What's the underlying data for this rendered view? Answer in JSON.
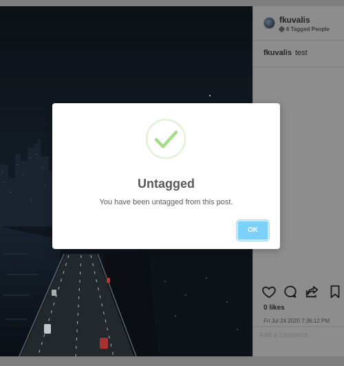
{
  "post": {
    "username": "fkuvalis",
    "tagged_people": "6 Tagged People",
    "caption_user": "fkuvalis",
    "caption_text": "test",
    "likes": "0 likes",
    "date": "Fri Jul 24 2020 7:36:12 PM",
    "comment_placeholder": "Add a comment..."
  },
  "icons": [
    "heart-icon",
    "comment-icon",
    "share-icon",
    "bookmark-icon",
    "tag-icon",
    "check-icon"
  ],
  "modal": {
    "title": "Untagged",
    "message": "You have been untagged from this post.",
    "ok_label": "OK",
    "accent_color": "#7cd1f9",
    "check_color": "#a5dc86"
  }
}
